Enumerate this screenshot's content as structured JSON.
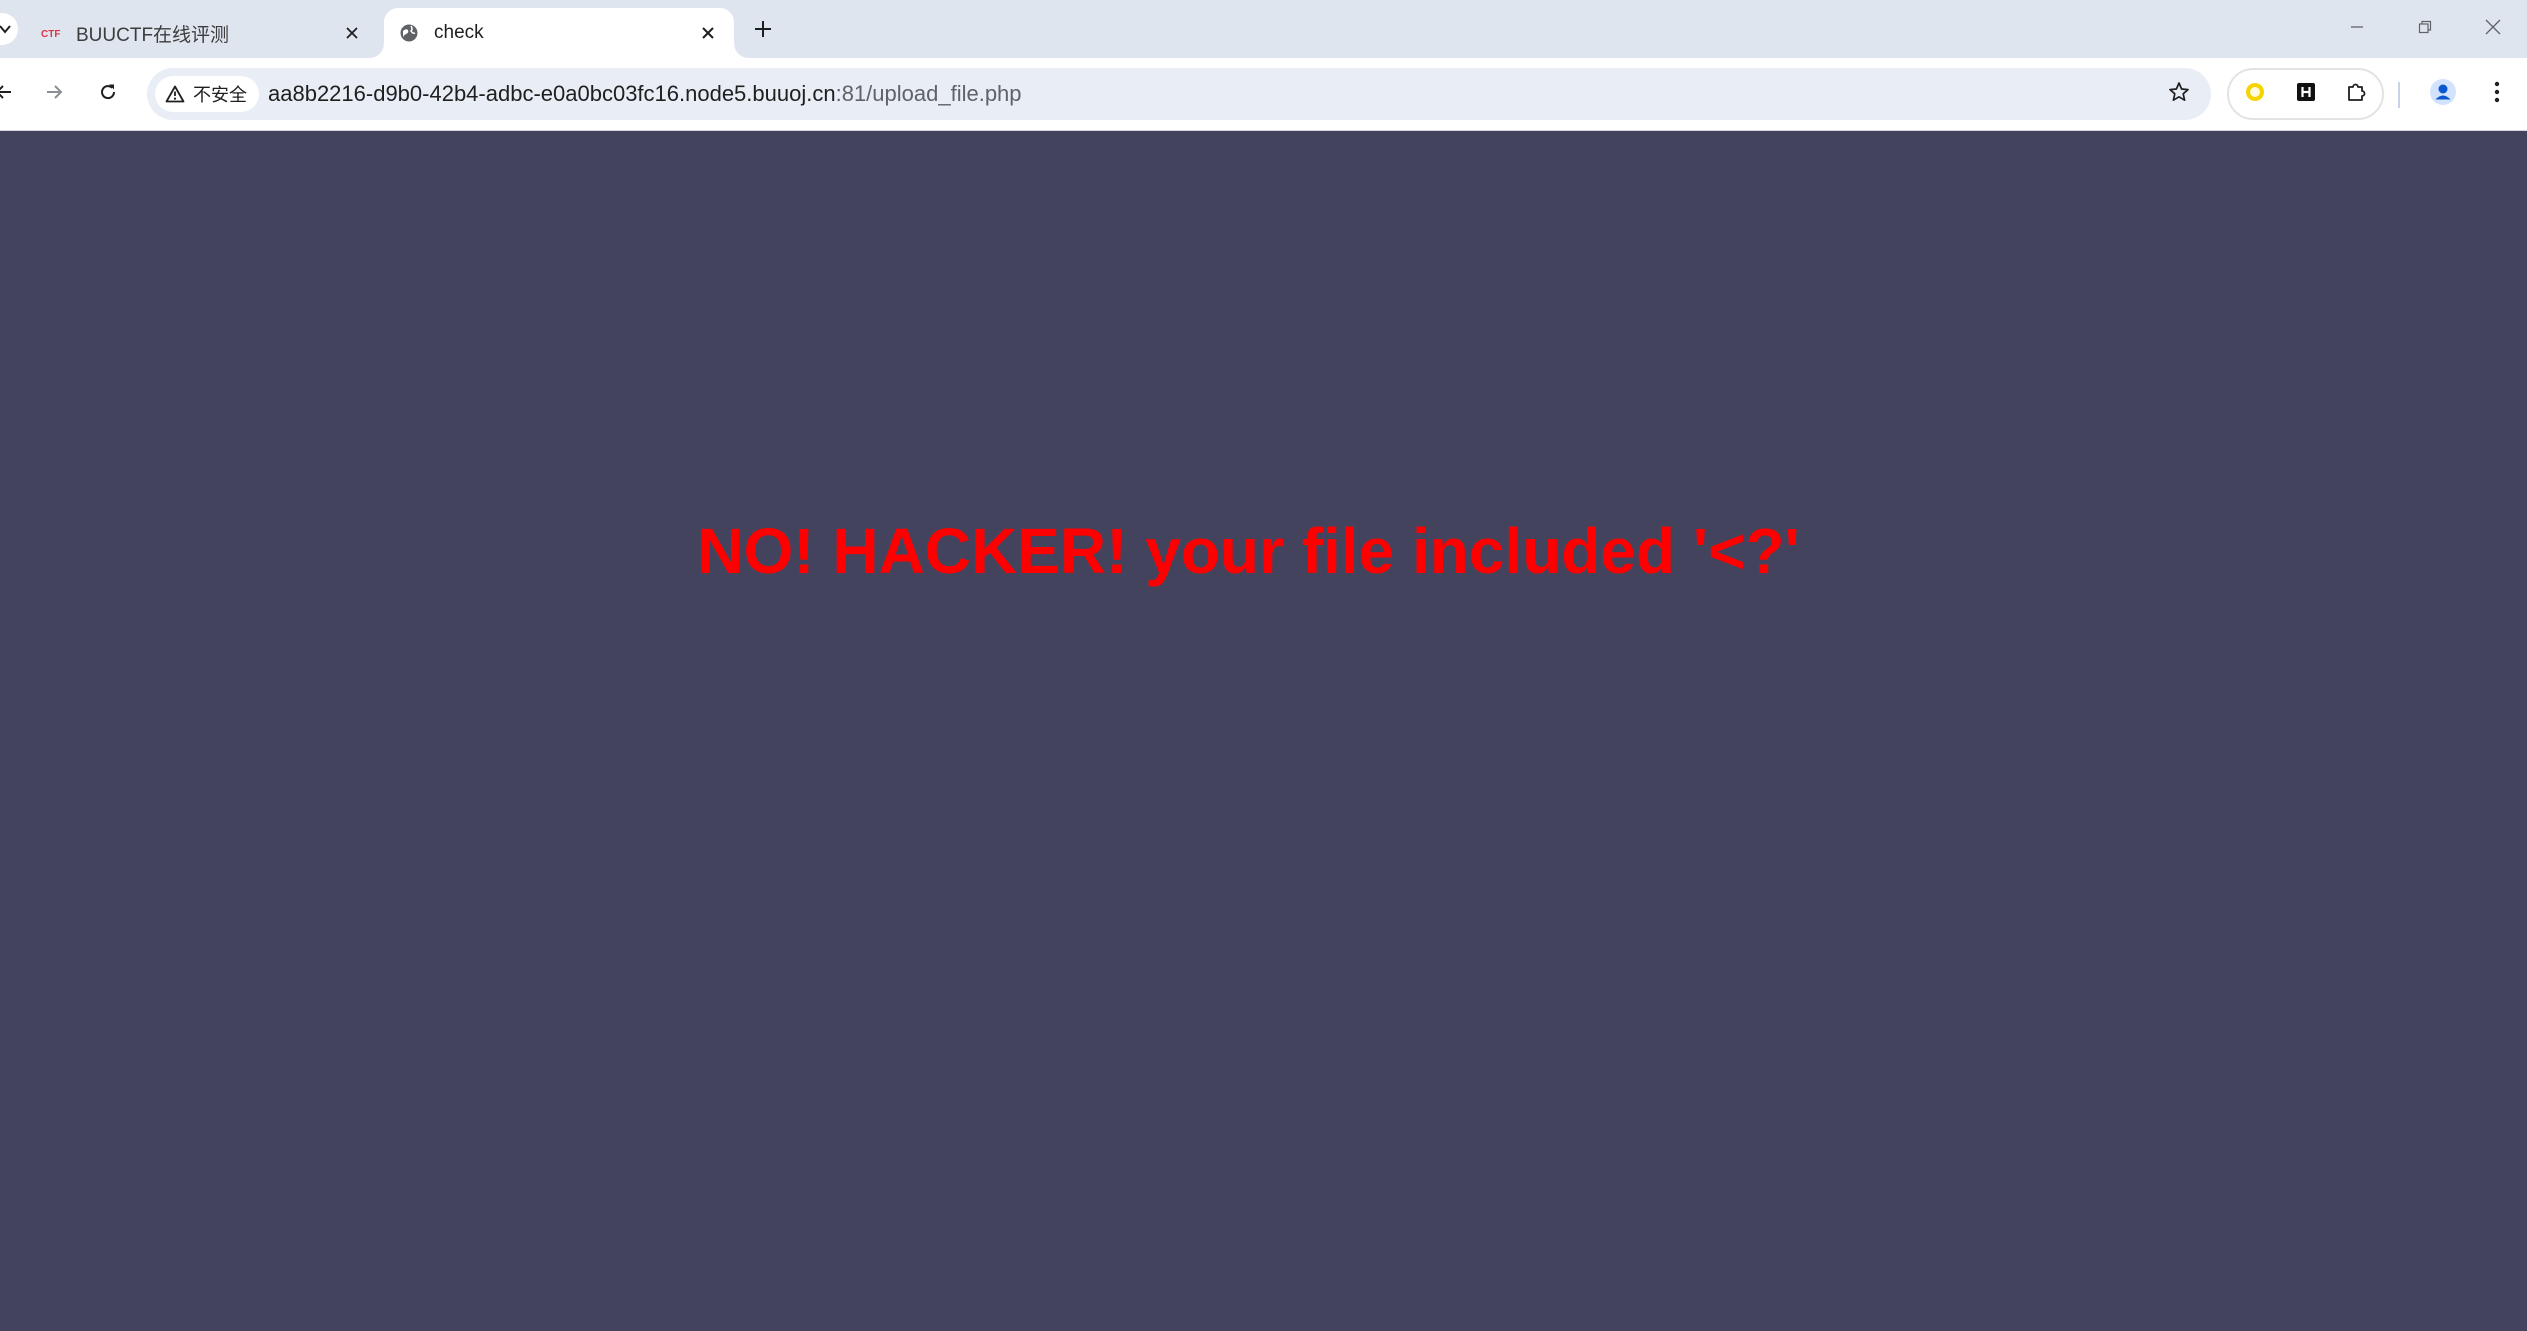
{
  "browser": {
    "tabs": [
      {
        "title": "BUUCTF在线评测",
        "favicon": "buuctf-logo-icon",
        "active": false
      },
      {
        "title": "check",
        "favicon": "globe-icon",
        "active": true
      }
    ],
    "new_tab_icon": "plus-icon",
    "window_controls": [
      "minimize-icon",
      "restore-icon",
      "close-icon"
    ],
    "address_bar": {
      "security_label": "不安全",
      "url_host": "aa8b2216-d9b0-42b4-adbc-e0a0bc03fc16.node5.buuoj.cn",
      "url_path": ":81/upload_file.php"
    },
    "extensions": [
      "yellow-circle-extension-icon",
      "h-extension-icon",
      "puzzle-icon"
    ]
  },
  "page": {
    "message": "NO! HACKER! your file included '<?'",
    "background_color": "#44435e",
    "message_color": "#ff0000"
  }
}
